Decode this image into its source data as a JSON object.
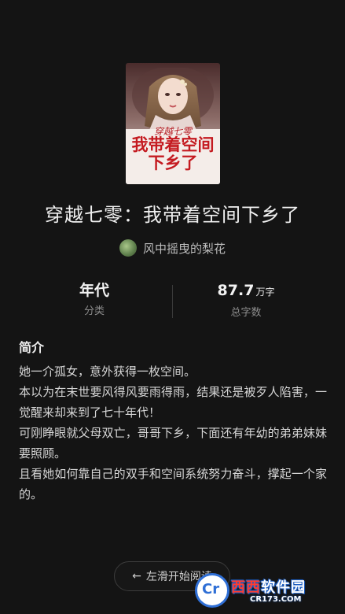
{
  "book": {
    "cover_tag": "穿越七零",
    "cover_title": "我带着空间下乡了",
    "title": "穿越七零：我带着空间下乡了",
    "author": "风中摇曳的梨花"
  },
  "stats": {
    "category_value": "年代",
    "category_label": "分类",
    "words_value": "87.7",
    "words_unit": "万字",
    "words_label": "总字数"
  },
  "intro": {
    "heading": "简介",
    "paragraphs": [
      "她一介孤女，意外获得一枚空间。",
      "本以为在末世要风得风要雨得雨，结果还是被歹人陷害，一觉醒来却来到了七十年代！",
      "可刚睁眼就父母双亡，哥哥下乡，下面还有年幼的弟弟妹妹要照顾。",
      "且看她如何靠自己的双手和空间系统努力奋斗，撑起一个家的。"
    ]
  },
  "swipe": {
    "arrow": "←",
    "label": "左滑开始阅读"
  },
  "watermark": {
    "logo": "Cr",
    "name_accent": "西西",
    "name": "软件园",
    "url": "CR173.COM"
  },
  "colors": {
    "background": "#141414",
    "cover_title": "#c41a20",
    "watermark_blue": "#2f6fd6"
  }
}
